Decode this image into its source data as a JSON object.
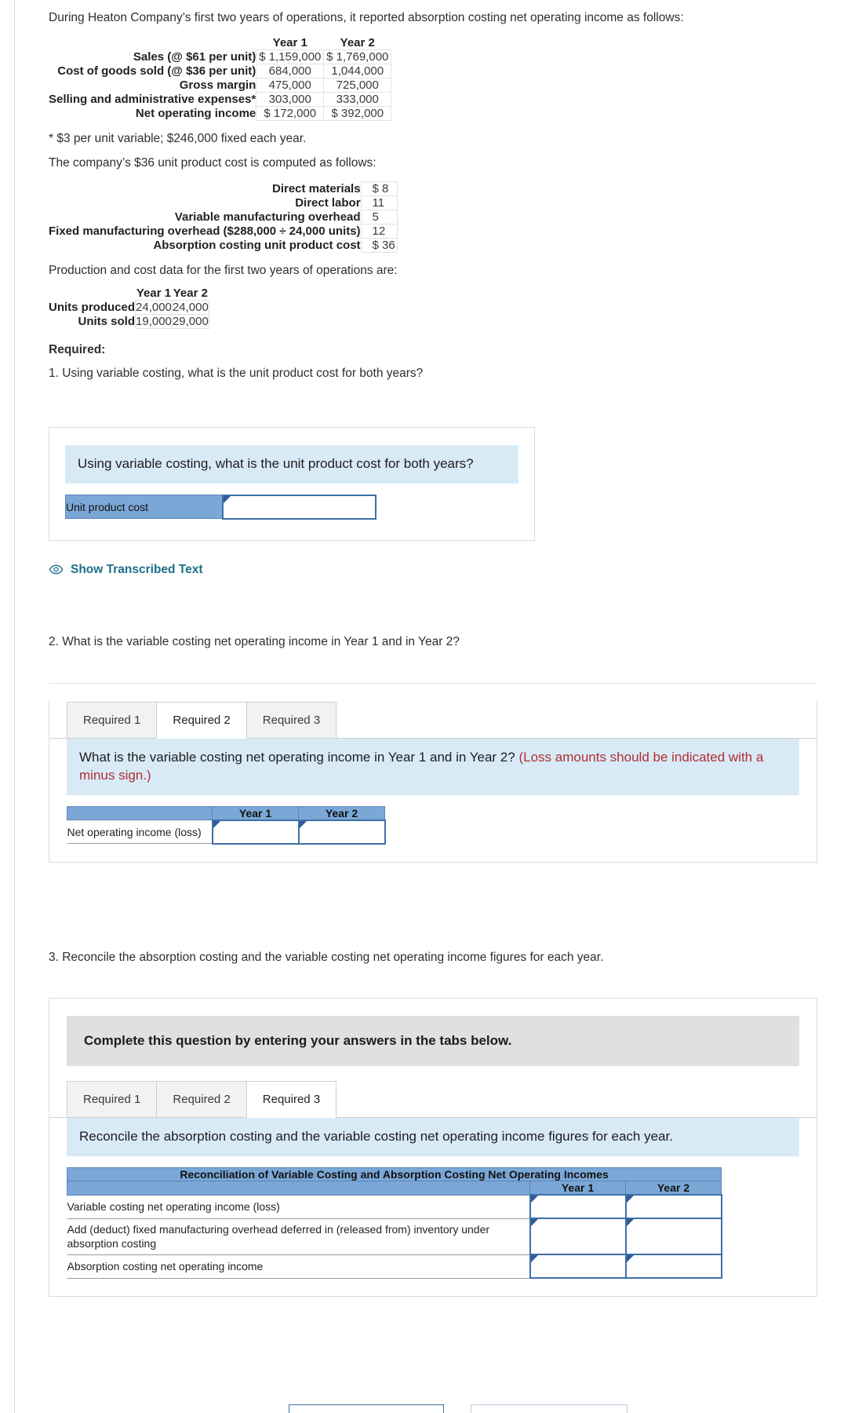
{
  "intro": {
    "lead": "During Heaton Company’s first two years of operations, it reported absorption costing net operating income as follows:",
    "footnote": "* $3 per unit variable; $246,000 fixed each year.",
    "unit_cost_lead": "The company’s $36 unit product cost is computed as follows:",
    "production_lead": "Production and cost data for the first two years of operations are:",
    "required_label": "Required:",
    "req1": "1. Using variable costing, what is the unit product cost for both years?",
    "req2": "2. What is the variable costing net operating income in Year 1 and in Year 2?",
    "req3": "3. Reconcile the absorption costing and the variable costing net operating income figures for each year."
  },
  "income_table": {
    "headers": [
      "Year 1",
      "Year 2"
    ],
    "rows": [
      {
        "label": "Sales (@ $61 per unit)",
        "year1": "$ 1,159,000",
        "year2": "$ 1,769,000"
      },
      {
        "label": "Cost of goods sold (@ $36 per unit)",
        "year1": "684,000",
        "year2": "1,044,000"
      },
      {
        "label": "Gross margin",
        "year1": "475,000",
        "year2": "725,000"
      },
      {
        "label": "Selling and administrative expenses*",
        "year1": "303,000",
        "year2": "333,000"
      },
      {
        "label": "Net operating income",
        "year1": "$ 172,000",
        "year2": "$ 392,000"
      }
    ]
  },
  "unit_cost_table": {
    "rows": [
      {
        "label": "Direct materials",
        "value": "$ 8"
      },
      {
        "label": "Direct labor",
        "value": "11"
      },
      {
        "label": "Variable manufacturing overhead",
        "value": "5"
      },
      {
        "label": "Fixed manufacturing overhead ($288,000 ÷ 24,000 units)",
        "value": "12"
      },
      {
        "label": "Absorption costing unit product cost",
        "value": "$ 36"
      }
    ]
  },
  "production_table": {
    "headers": [
      "Year 1",
      "Year 2"
    ],
    "rows": [
      {
        "label": "Units produced",
        "year1": "24,000",
        "year2": "24,000"
      },
      {
        "label": "Units sold",
        "year1": "19,000",
        "year2": "29,000"
      }
    ]
  },
  "panel1": {
    "question": "Using variable costing, what is the unit product cost for both years?",
    "row_label": "Unit product cost",
    "input_value": ""
  },
  "transcribe_link": {
    "label": "Show Transcribed Text",
    "icon": "eye-icon"
  },
  "card2": {
    "tabs": [
      {
        "label": "Required 1",
        "active": false
      },
      {
        "label": "Required 2",
        "active": true
      },
      {
        "label": "Required 3",
        "active": false
      }
    ],
    "question": "What is the variable costing net operating income in Year 1 and in Year 2?",
    "question_note": "(Loss amounts should be indicated with a minus sign.)",
    "grid": {
      "headers": [
        "",
        "Year 1",
        "Year 2"
      ],
      "rows": [
        {
          "label": "Net operating income (loss)",
          "year1": "",
          "year2": ""
        }
      ]
    }
  },
  "card3": {
    "head": "Complete this question by entering your answers in the tabs below.",
    "tabs": [
      {
        "label": "Required 1",
        "active": false
      },
      {
        "label": "Required 2",
        "active": false
      },
      {
        "label": "Required 3",
        "active": true
      }
    ],
    "question": "Reconcile the absorption costing and the variable costing net operating income figures for each year.",
    "grid": {
      "title": "Reconciliation of Variable Costing and Absorption Costing Net Operating Incomes",
      "headers": [
        "",
        "Year 1",
        "Year 2"
      ],
      "rows": [
        {
          "label": "Variable costing net operating income (loss)",
          "year1": "",
          "year2": ""
        },
        {
          "label": "Add (deduct) fixed manufacturing overhead deferred in (released from) inventory under absorption costing",
          "year1": "",
          "year2": ""
        },
        {
          "label": "Absorption costing net operating income",
          "year1": "",
          "year2": ""
        }
      ]
    }
  },
  "colors": {
    "grid_blue": "#7ba7d7",
    "banner_blue": "#d9eaf7",
    "input_border": "#3f6fa8",
    "link_teal": "#1d6f8b",
    "warn_red": "#b03030",
    "card_head_gray": "#e0e0e0"
  }
}
